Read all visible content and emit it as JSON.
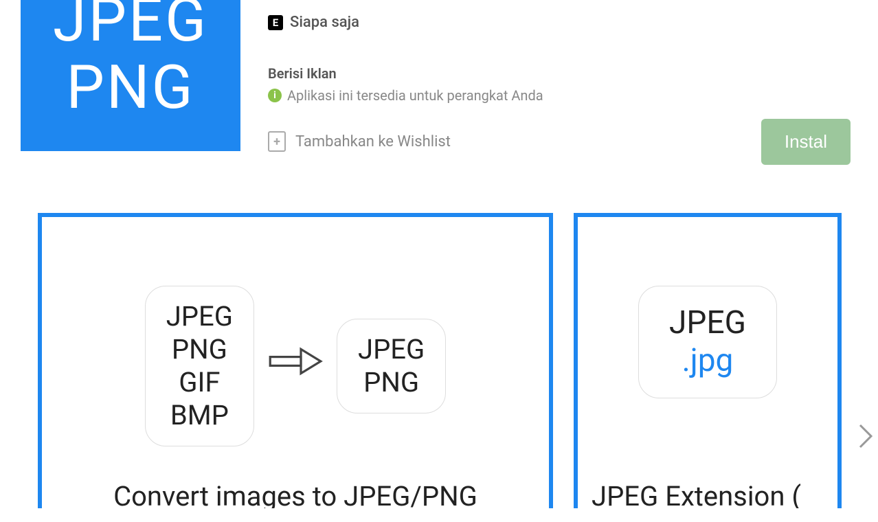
{
  "icon": {
    "line1": "JPEG",
    "line2": "PNG"
  },
  "rating": {
    "badge": "E",
    "label": "Siapa saja"
  },
  "ads_label": "Berisi Iklan",
  "availability": "Aplikasi ini tersedia untuk perangkat Anda",
  "wishlist_label": "Tambahkan ke Wishlist",
  "install_label": "Instal",
  "screens": {
    "card1": {
      "left_tile": [
        "JPEG",
        "PNG",
        "GIF",
        "BMP"
      ],
      "right_tile": [
        "JPEG",
        "PNG"
      ],
      "caption": "Convert images to JPEG/PNG"
    },
    "card2": {
      "tile_line1": "JPEG",
      "tile_line2": ".jpg",
      "caption": "JPEG Extension ("
    }
  }
}
